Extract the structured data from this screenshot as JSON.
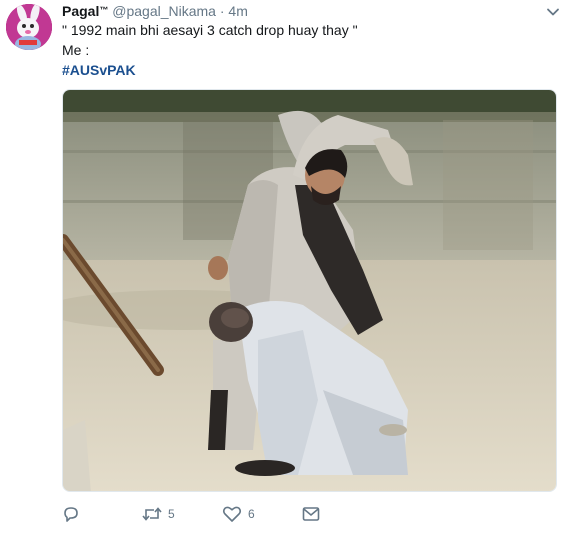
{
  "tweet": {
    "display_name": "Pagal",
    "tm": "™",
    "handle": "@pagal_Nikama",
    "separator": "·",
    "time": "4m",
    "lines": [
      "\" 1992 main bhi aesayi 3 catch drop huay thay \"",
      "Me :"
    ],
    "hashtag": "#AUSvPAK"
  },
  "actions": {
    "reply_count": "",
    "retweet_count": "5",
    "like_count": "6"
  },
  "icons": {
    "caret": "chevron-down-icon",
    "reply": "reply-icon",
    "retweet": "retweet-icon",
    "like": "heart-icon",
    "message": "envelope-icon"
  },
  "colors": {
    "text": "#14171a",
    "secondary": "#657786",
    "hashtag": "#1b4f8f"
  }
}
